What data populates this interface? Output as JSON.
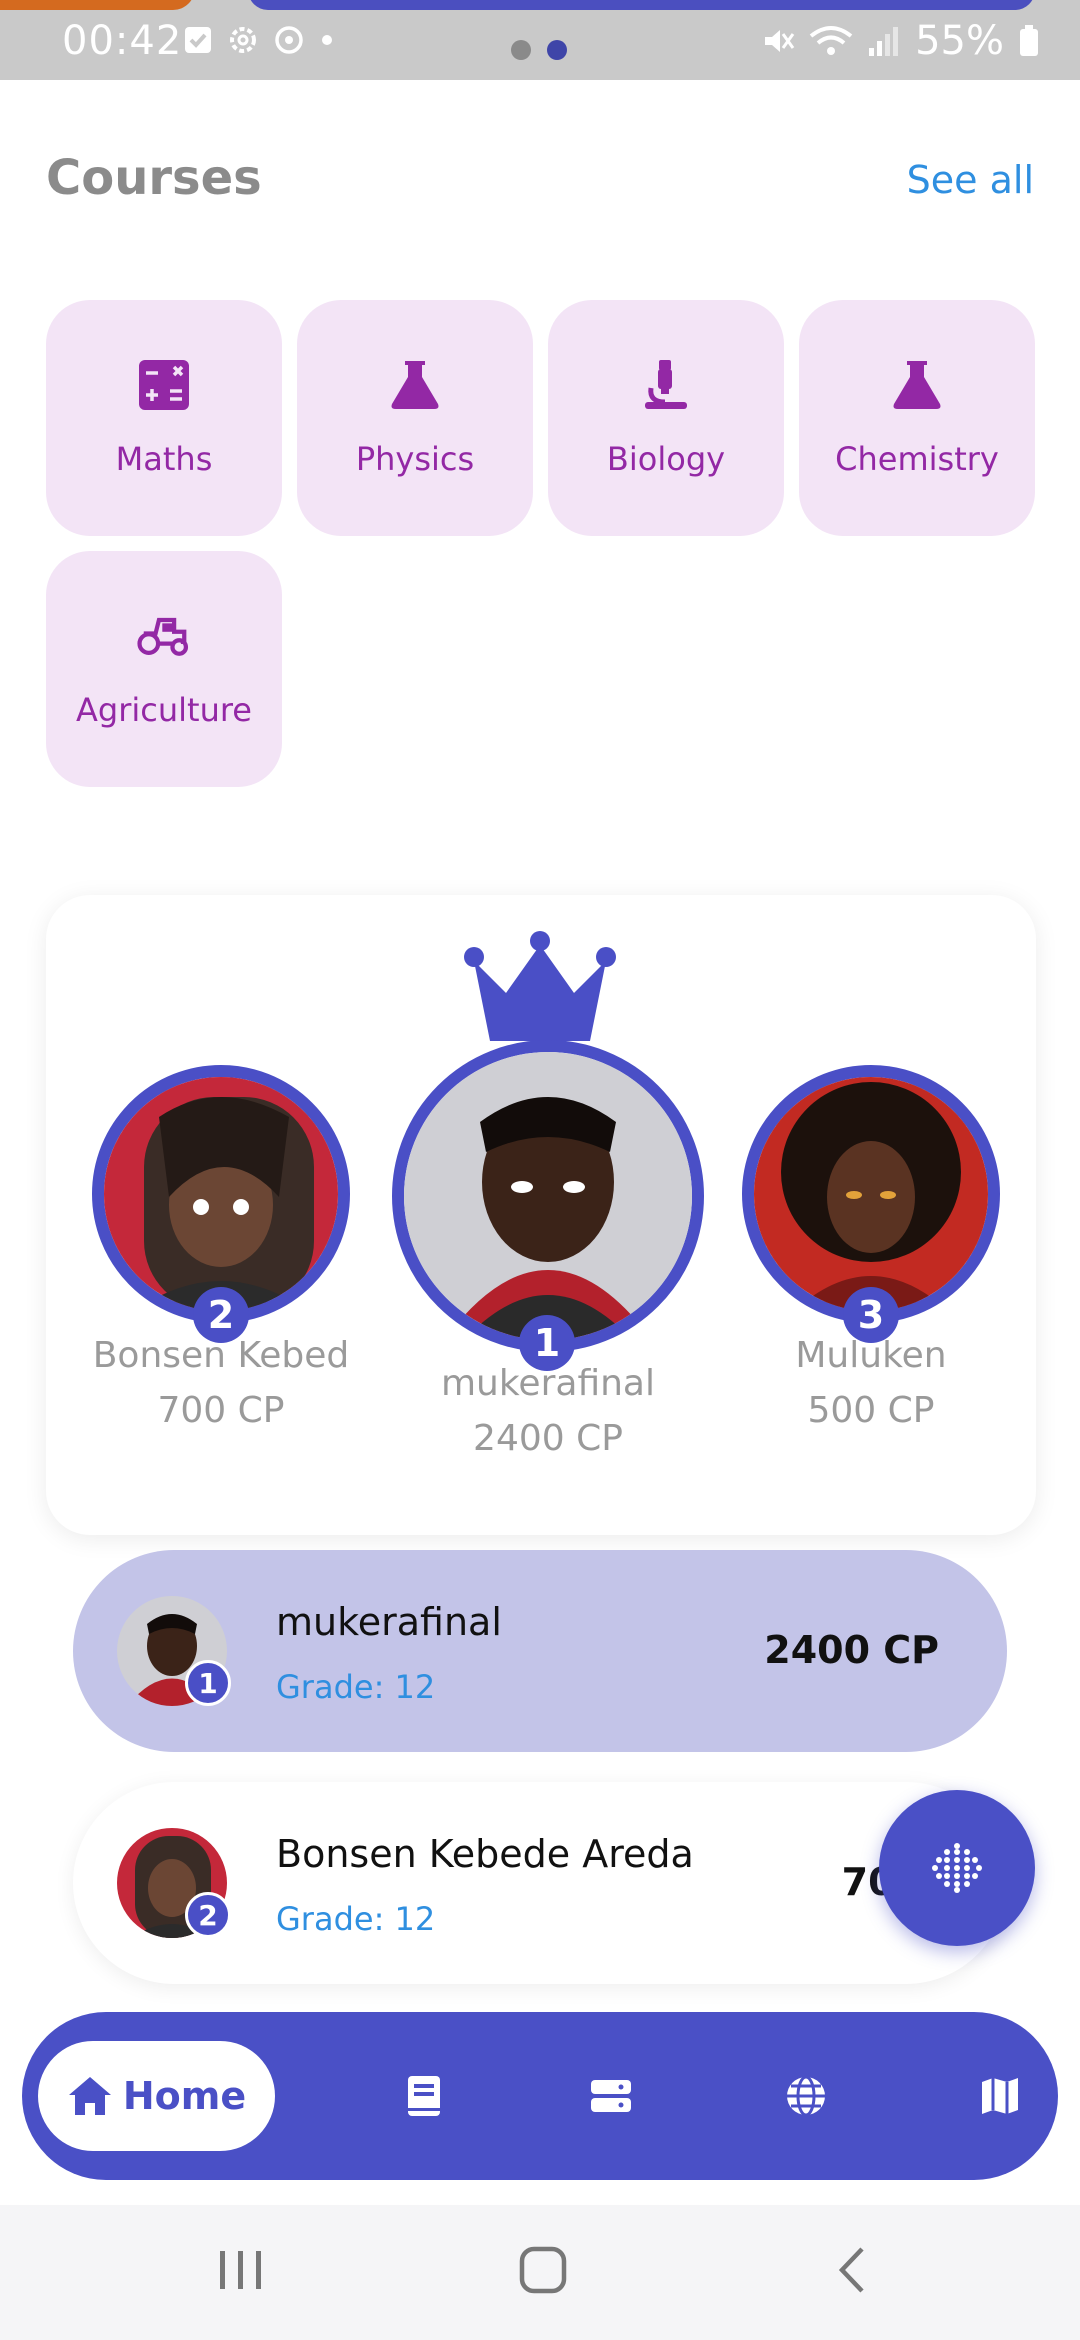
{
  "status_bar": {
    "time": "00:42",
    "battery": "55%"
  },
  "courses": {
    "title": "Courses",
    "see_all": "See all",
    "items": [
      {
        "label": "Maths",
        "icon": "calculator-icon"
      },
      {
        "label": "Physics",
        "icon": "flask-icon"
      },
      {
        "label": "Biology",
        "icon": "microscope-icon"
      },
      {
        "label": "Chemistry",
        "icon": "flask-icon"
      },
      {
        "label": "Agriculture",
        "icon": "tractor-icon"
      }
    ]
  },
  "podium": {
    "first": {
      "rank": "1",
      "name": "mukerafinal",
      "cp": "2400 CP"
    },
    "second": {
      "rank": "2",
      "name": "Bonsen Kebed",
      "cp": "700 CP"
    },
    "third": {
      "rank": "3",
      "name": "Muluken",
      "cp": "500 CP"
    }
  },
  "list": [
    {
      "rank": "1",
      "name": "mukerafinal",
      "grade": "Grade: 12",
      "cp": "2400 CP"
    },
    {
      "rank": "2",
      "name": "Bonsen Kebede Areda",
      "grade": "Grade: 12",
      "cp": "700"
    }
  ],
  "bottom_nav": {
    "home_label": "Home",
    "items": [
      "book-icon",
      "server-icon",
      "globe-icon",
      "map-icon"
    ]
  },
  "colors": {
    "primary": "#4a50c6",
    "course_bg": "#f3e4f6",
    "course_text": "#9328a5",
    "link": "#2f8fe0",
    "highlight_row": "#c3c4e8"
  }
}
